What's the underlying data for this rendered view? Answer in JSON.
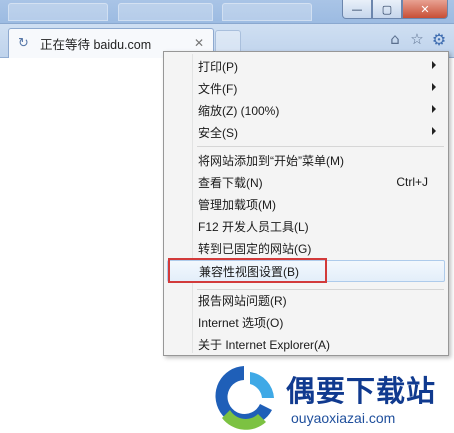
{
  "tab": {
    "title": "正在等待 baidu.com",
    "loading_icon": "reload-icon",
    "close_icon": "close-icon"
  },
  "window_buttons": {
    "minimize": "—",
    "maximize": "▢",
    "close": "✕"
  },
  "toolbar": {
    "home": "⌂",
    "favorites": "☆",
    "tools": "⚙"
  },
  "menu": {
    "items": [
      {
        "label": "打印(P)",
        "submenu": true
      },
      {
        "label": "文件(F)",
        "submenu": true
      },
      {
        "label": "缩放(Z) (100%)",
        "submenu": true
      },
      {
        "label": "安全(S)",
        "submenu": true
      },
      {
        "label": "将网站添加到“开始”菜单(M)"
      },
      {
        "label": "查看下载(N)",
        "shortcut": "Ctrl+J"
      },
      {
        "label": "管理加载项(M)"
      },
      {
        "label": "F12 开发人员工具(L)"
      },
      {
        "label": "转到已固定的网站(G)"
      },
      {
        "label": "兼容性视图设置(B)",
        "highlighted": true
      },
      {
        "label": "报告网站问题(R)"
      },
      {
        "label": "Internet 选项(O)"
      },
      {
        "label": "关于 Internet Explorer(A)"
      }
    ]
  },
  "watermark": {
    "brand": "偶要下载站",
    "url": "ouyaoxiazai.com"
  },
  "colors": {
    "highlight_box": "#d23a3a",
    "brand_blue": "#103a8f",
    "menu_bg": "#f4f4f4"
  }
}
